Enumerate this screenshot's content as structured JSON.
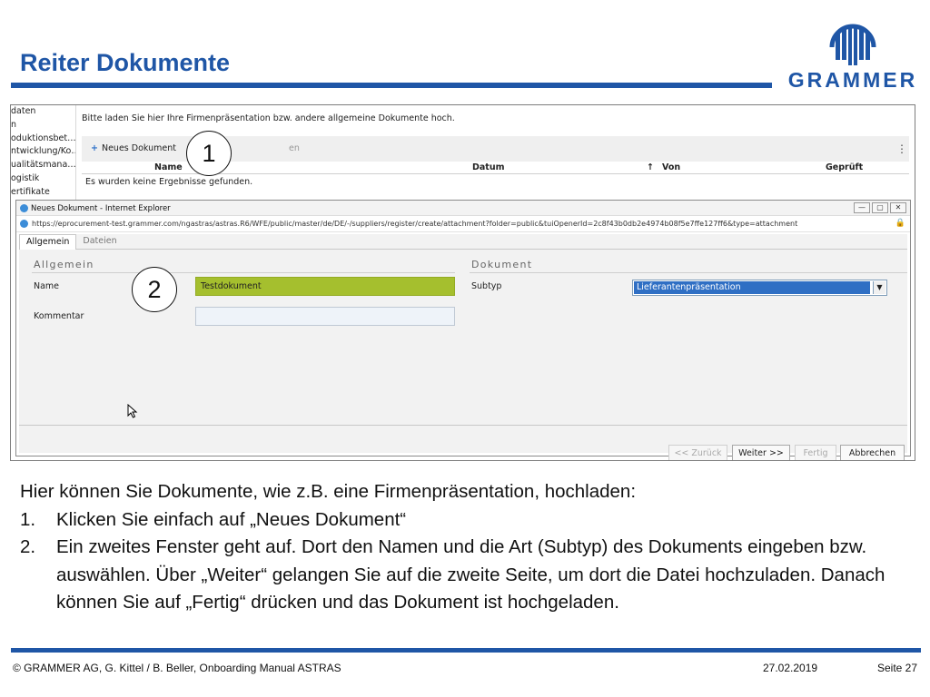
{
  "slide": {
    "title": "Reiter Dokumente",
    "logo_text": "GRAMMER",
    "footer_left": "© GRAMMER AG, G. Kittel / B. Beller, Onboarding Manual ASTRAS",
    "footer_date": "27.02.2019",
    "footer_page": "Seite 27"
  },
  "background_app": {
    "sidebar_items": [
      "daten",
      "n",
      "oduktionsbet…",
      "ntwicklung/Ko…",
      "ualitätsmana…",
      "ogistik",
      "ertifikate"
    ],
    "hint": "Bitte laden Sie hier Ihre Firmenpräsentation bzw. andere allgemeine Dokumente hoch.",
    "new_doc_button": "Neues Dokument",
    "new_doc_cut": "en",
    "columns": [
      "Name",
      "Datum",
      "Von",
      "Geprüft"
    ],
    "empty_text": "Es wurden keine Ergebnisse gefunden."
  },
  "dialog": {
    "window_title": "Neues Dokument - Internet Explorer",
    "url": "https://eprocurement-test.grammer.com/ngastras/astras.R6/WFE/public/master/de/DE/-/suppliers/register/create/attachment?folder=public&tuiOpenerId=2c8f43b0db2e4974b08f5e7ffe127ff6&type=attachment",
    "tabs": [
      "Allgemein",
      "Dateien"
    ],
    "section_general": "Allgemein",
    "section_document": "Dokument",
    "name_label": "Name",
    "name_value": "Testdokument",
    "comment_label": "Kommentar",
    "comment_value": "",
    "subtype_label": "Subtyp",
    "subtype_value": "Lieferantenpräsentation",
    "buttons": {
      "back": "<< Zurück",
      "next": "Weiter >>",
      "finish": "Fertig",
      "cancel": "Abbrechen"
    }
  },
  "callouts": [
    "1",
    "2"
  ],
  "instructions": {
    "intro": "Hier können Sie Dokumente, wie z.B. eine Firmenpräsentation, hochladen:",
    "steps": [
      {
        "num": "1.",
        "text": "Klicken Sie einfach auf „Neues Dokument“"
      },
      {
        "num": "2.",
        "text": "Ein zweites Fenster geht auf. Dort den Namen und die Art (Subtyp) des Dokuments eingeben bzw. auswählen. Über „Weiter“ gelangen Sie auf die zweite Seite, um dort die Datei hochzuladen. Danach können Sie auf „Fertig“ drücken und das Dokument ist hochgeladen."
      }
    ]
  },
  "colors": {
    "brand_blue": "#1f56a6",
    "name_field_green": "#a5bf2e",
    "select_highlight": "#2f6fc4"
  }
}
